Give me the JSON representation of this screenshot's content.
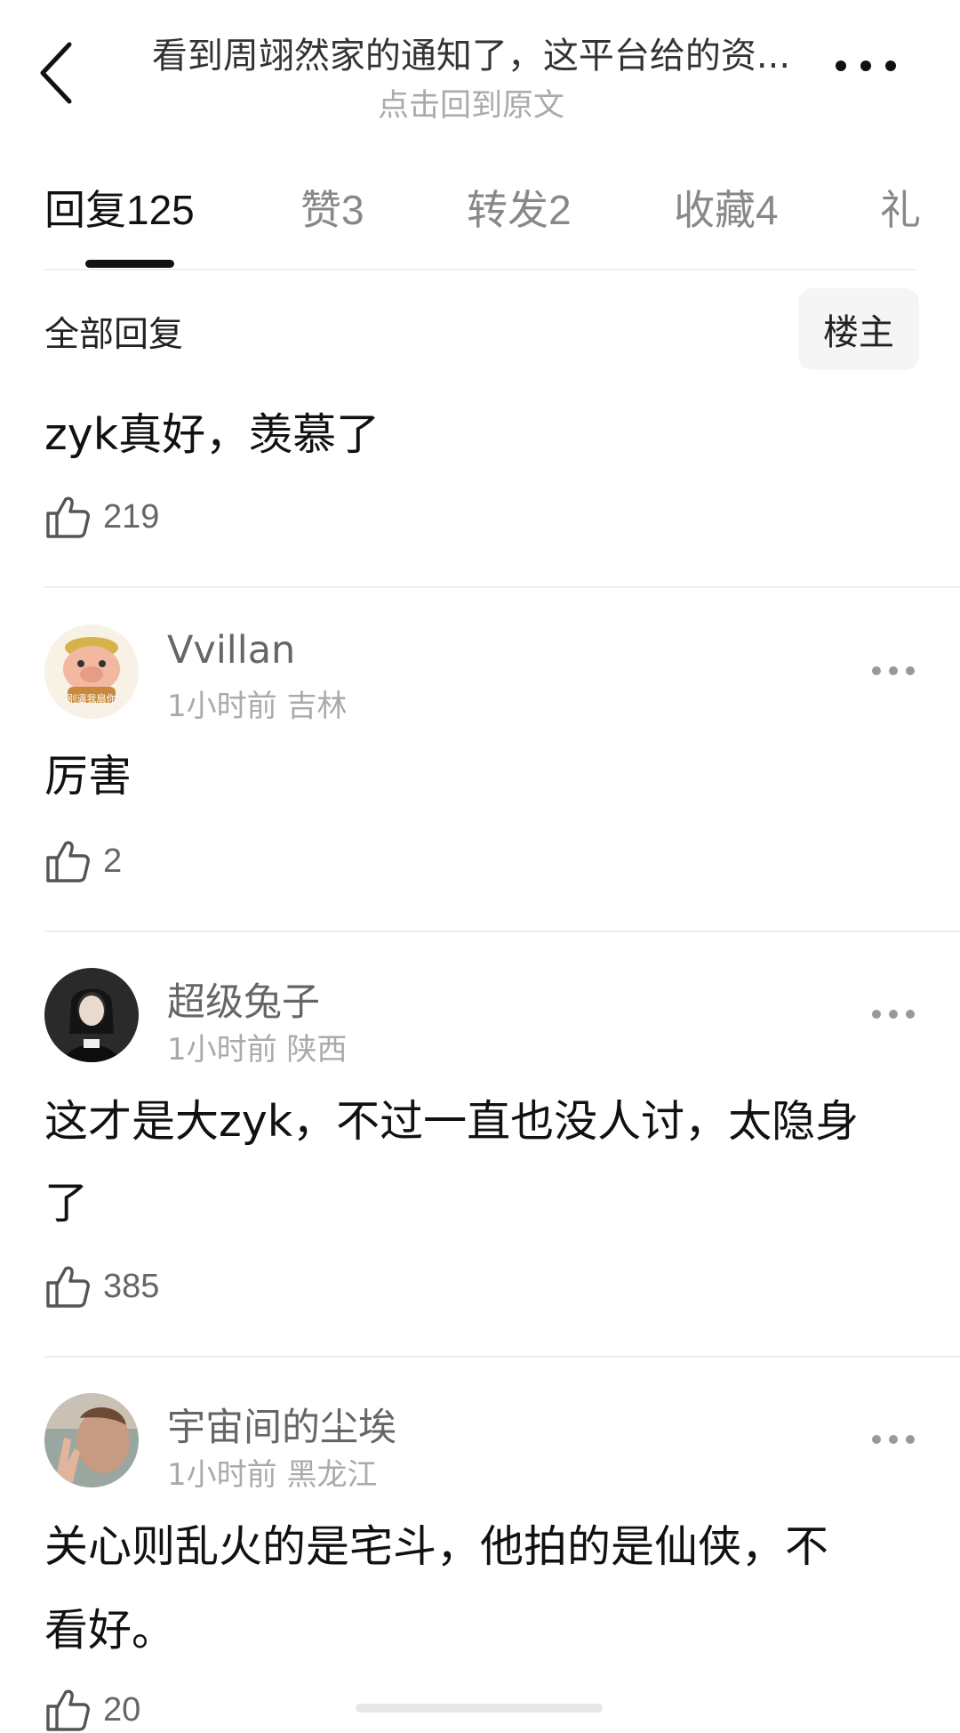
{
  "header": {
    "title": "看到周翊然家的通知了，这平台给的资...",
    "subtitle": "点击回到原文"
  },
  "tabs": [
    {
      "label": "回复",
      "count": "125",
      "active": true
    },
    {
      "label": "赞",
      "count": "3",
      "active": false
    },
    {
      "label": "转发",
      "count": "2",
      "active": false
    },
    {
      "label": "收藏",
      "count": "4",
      "active": false
    },
    {
      "label": "礼",
      "count": "",
      "active": false
    }
  ],
  "filter": {
    "all_replies": "全部回复",
    "op_only": "楼主"
  },
  "op_post": {
    "text": "zyk真好，羡慕了",
    "likes": "219"
  },
  "comments": [
    {
      "username": "Vvillan",
      "time": "1小时前",
      "location": "吉林",
      "avatar_badge": "别逼我扇你",
      "text_lines": [
        "厉害"
      ],
      "likes": "2"
    },
    {
      "username": "超级兔子",
      "time": "1小时前",
      "location": "陕西",
      "text_lines": [
        "这才是大zyk，不过一直也没人讨，太隐身",
        "了"
      ],
      "likes": "385"
    },
    {
      "username": "宇宙间的尘埃",
      "time": "1小时前",
      "location": "黑龙江",
      "text_lines": [
        "关心则乱火的是宅斗，他拍的是仙侠，不",
        "看好。"
      ],
      "likes": "20"
    }
  ]
}
